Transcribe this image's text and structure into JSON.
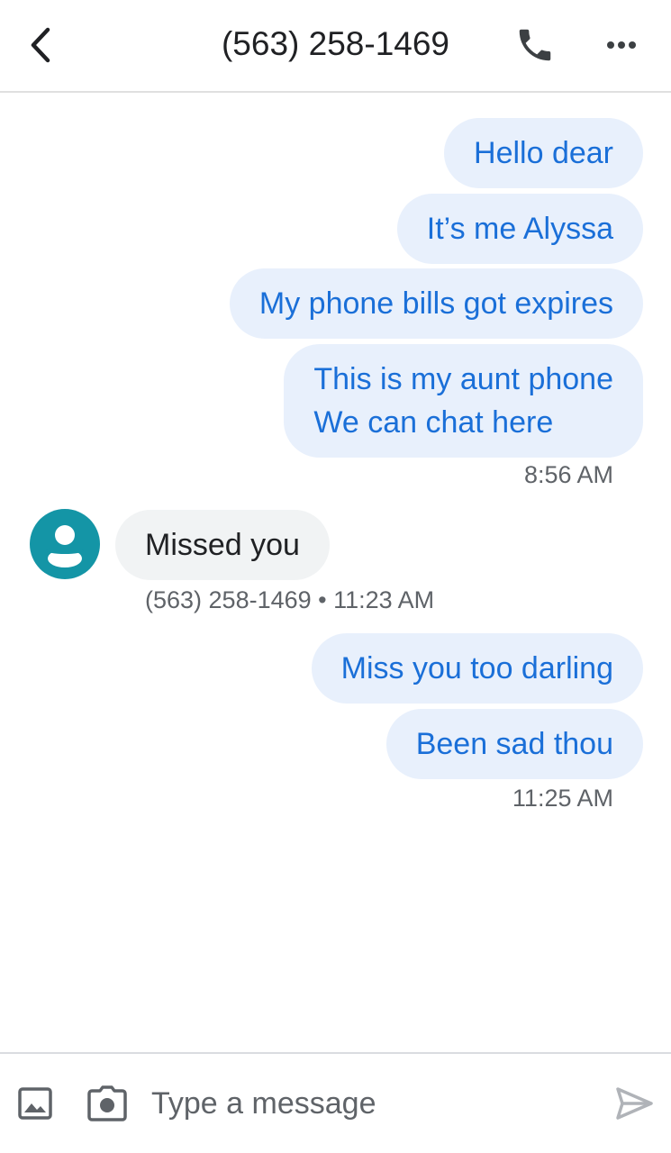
{
  "header": {
    "title": "(563) 258-1469",
    "back_icon": "chevron-left-icon",
    "call_icon": "phone-icon",
    "more_icon": "more-horizontal-icon"
  },
  "messages": {
    "m1": "Hello dear",
    "m2": "It’s me Alyssa",
    "m3": "My phone bills got expires",
    "m4_line1": "This is my aunt phone",
    "m4_line2": "We can chat here",
    "time1": "8:56 AM",
    "m5": "Missed you",
    "meta2": "(563) 258-1469 • 11:23 AM",
    "m6": "Miss you too darling",
    "m7": "Been sad thou",
    "time3": "11:25 AM"
  },
  "composer": {
    "placeholder": "Type a message",
    "gallery_icon": "image-icon",
    "camera_icon": "camera-icon",
    "send_icon": "send-icon"
  },
  "colors": {
    "outgoing_bubble": "#e8f0fc",
    "outgoing_text": "#1a6fd8",
    "incoming_bubble": "#f1f3f4",
    "avatar": "#1495a6"
  }
}
